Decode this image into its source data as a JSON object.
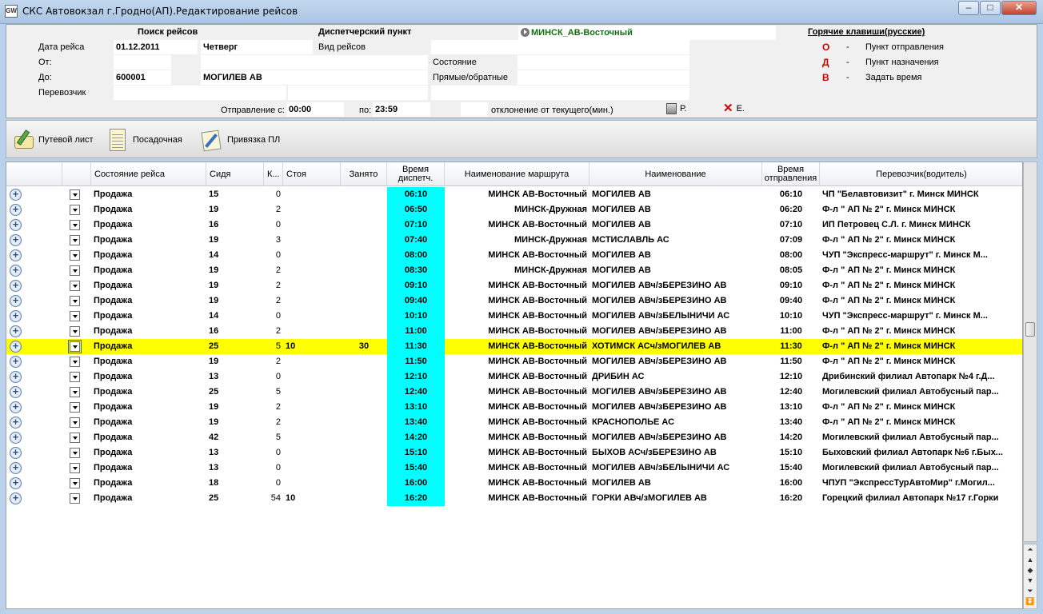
{
  "window": {
    "title": "СКС Автовокзал г.Гродно(АП).Редактирование рейсов",
    "logo": "GW",
    "minimize": "–",
    "maximize": "□",
    "close": "✕"
  },
  "search": {
    "header": "Поиск рейсов",
    "date_label": "Дата рейса",
    "date_value": "01.12.2011",
    "weekday": "Четверг",
    "from_label": "От:",
    "to_label": "До:",
    "to_code": "600001",
    "to_name": "МОГИЛЕВ АВ",
    "carrier_label": "Перевозчик",
    "dep_from_label": "Отправление с:",
    "dep_from_value": "00:00",
    "dep_to_label": "по:",
    "dep_to_value": "23:59",
    "deviation_label": "отклонение от текущего(мин.)",
    "print_label": "Р.",
    "clear_label": "Е."
  },
  "dispatch": {
    "header": "Диспетчерский пункт",
    "point": "МИНСК_АВ-Восточный",
    "trip_type_label": "Вид рейсов",
    "state_label": "Состояние",
    "direction_label": "Прямые/обратные"
  },
  "hotkeys": {
    "header": "Горячие клавиши(русские)",
    "items": [
      {
        "key": "О",
        "dash": "-",
        "desc": "Пункт отправления"
      },
      {
        "key": "Д",
        "dash": "-",
        "desc": "Пункт назначения"
      },
      {
        "key": "В",
        "dash": "-",
        "desc": "Задать время"
      }
    ]
  },
  "toolbar": {
    "waybill": "Путевой лист",
    "boarding": "Посадочная",
    "binding": "Привязка ПЛ"
  },
  "grid": {
    "columns": {
      "state": "Состояние рейса",
      "seats": "Сидя",
      "k": "К...",
      "stand": "Стоя",
      "taken": "Занято",
      "disp_time": "Время диспетч.",
      "route": "Наименование маршрута",
      "name": "Наименование",
      "dep_time": "Время отправления",
      "carrier": "Перевозчик(водитель)"
    },
    "rows": [
      {
        "state": "Продажа",
        "seats": "15",
        "k": "0",
        "stand": "",
        "taken": "",
        "disp": "06:10",
        "route": "МИНСК АВ-Восточный",
        "name": "МОГИЛЕВ АВ",
        "dep": "06:10",
        "carrier": "ЧП \"Белавтовизит\" г. Минск МИНСК"
      },
      {
        "state": "Продажа",
        "seats": "19",
        "k": "2",
        "stand": "",
        "taken": "",
        "disp": "06:50",
        "route": "МИНСК-Дружная",
        "name": "МОГИЛЕВ АВ",
        "dep": "06:20",
        "carrier": "Ф-л \" АП № 2\" г. Минск МИНСК"
      },
      {
        "state": "Продажа",
        "seats": "16",
        "k": "0",
        "stand": "",
        "taken": "",
        "disp": "07:10",
        "route": "МИНСК АВ-Восточный",
        "name": "МОГИЛЕВ АВ",
        "dep": "07:10",
        "carrier": "ИП Петровец С.Л. г. Минск МИНСК"
      },
      {
        "state": "Продажа",
        "seats": "19",
        "k": "3",
        "stand": "",
        "taken": "",
        "disp": "07:40",
        "route": "МИНСК-Дружная",
        "name": "МСТИСЛАВЛЬ АС",
        "dep": "07:09",
        "carrier": "Ф-л \" АП № 2\" г. Минск МИНСК"
      },
      {
        "state": "Продажа",
        "seats": "14",
        "k": "0",
        "stand": "",
        "taken": "",
        "disp": "08:00",
        "route": "МИНСК АВ-Восточный",
        "name": "МОГИЛЕВ АВ",
        "dep": "08:00",
        "carrier": "ЧУП \"Экспресс-маршрут\" г. Минск М..."
      },
      {
        "state": "Продажа",
        "seats": "19",
        "k": "2",
        "stand": "",
        "taken": "",
        "disp": "08:30",
        "route": "МИНСК-Дружная",
        "name": "МОГИЛЕВ АВ",
        "dep": "08:05",
        "carrier": "Ф-л \" АП № 2\" г. Минск МИНСК"
      },
      {
        "state": "Продажа",
        "seats": "19",
        "k": "2",
        "stand": "",
        "taken": "",
        "disp": "09:10",
        "route": "МИНСК АВ-Восточный",
        "name": "МОГИЛЕВ АВч/зБЕРЕЗИНО АВ",
        "dep": "09:10",
        "carrier": "Ф-л \" АП № 2\" г. Минск МИНСК"
      },
      {
        "state": "Продажа",
        "seats": "19",
        "k": "2",
        "stand": "",
        "taken": "",
        "disp": "09:40",
        "route": "МИНСК АВ-Восточный",
        "name": "МОГИЛЕВ АВч/зБЕРЕЗИНО АВ",
        "dep": "09:40",
        "carrier": "Ф-л \" АП № 2\" г. Минск МИНСК"
      },
      {
        "state": "Продажа",
        "seats": "14",
        "k": "0",
        "stand": "",
        "taken": "",
        "disp": "10:10",
        "route": "МИНСК АВ-Восточный",
        "name": "МОГИЛЕВ АВч/зБЕЛЫНИЧИ АС",
        "dep": "10:10",
        "carrier": "ЧУП \"Экспресс-маршрут\" г. Минск М..."
      },
      {
        "state": "Продажа",
        "seats": "16",
        "k": "2",
        "stand": "",
        "taken": "",
        "disp": "11:00",
        "route": "МИНСК АВ-Восточный",
        "name": "МОГИЛЕВ АВч/зБЕРЕЗИНО АВ",
        "dep": "11:00",
        "carrier": "Ф-л \" АП № 2\" г. Минск МИНСК"
      },
      {
        "state": "Продажа",
        "seats": "25",
        "k": "5",
        "stand": "10",
        "taken": "30",
        "disp": "11:30",
        "route": "МИНСК АВ-Восточный",
        "name": "ХОТИМСК АСч/зМОГИЛЕВ АВ",
        "dep": "11:30",
        "carrier": "Ф-л \" АП № 2\" г. Минск МИНСК",
        "selected": true
      },
      {
        "state": "Продажа",
        "seats": "19",
        "k": "2",
        "stand": "",
        "taken": "",
        "disp": "11:50",
        "route": "МИНСК АВ-Восточный",
        "name": "МОГИЛЕВ АВч/зБЕРЕЗИНО АВ",
        "dep": "11:50",
        "carrier": "Ф-л \" АП № 2\" г. Минск МИНСК"
      },
      {
        "state": "Продажа",
        "seats": "13",
        "k": "0",
        "stand": "",
        "taken": "",
        "disp": "12:10",
        "route": "МИНСК АВ-Восточный",
        "name": "ДРИБИН АС",
        "dep": "12:10",
        "carrier": "Дрибинский филиал Автопарк №4 г.Д..."
      },
      {
        "state": "Продажа",
        "seats": "25",
        "k": "5",
        "stand": "",
        "taken": "",
        "disp": "12:40",
        "route": "МИНСК АВ-Восточный",
        "name": "МОГИЛЕВ АВч/зБЕРЕЗИНО АВ",
        "dep": "12:40",
        "carrier": "Могилевский филиал Автобусный пар..."
      },
      {
        "state": "Продажа",
        "seats": "19",
        "k": "2",
        "stand": "",
        "taken": "",
        "disp": "13:10",
        "route": "МИНСК АВ-Восточный",
        "name": "МОГИЛЕВ АВч/зБЕРЕЗИНО АВ",
        "dep": "13:10",
        "carrier": "Ф-л \" АП № 2\" г. Минск МИНСК"
      },
      {
        "state": "Продажа",
        "seats": "19",
        "k": "2",
        "stand": "",
        "taken": "",
        "disp": "13:40",
        "route": "МИНСК АВ-Восточный",
        "name": "КРАСНОПОЛЬЕ АС",
        "dep": "13:40",
        "carrier": "Ф-л \" АП № 2\" г. Минск МИНСК"
      },
      {
        "state": "Продажа",
        "seats": "42",
        "k": "5",
        "stand": "",
        "taken": "",
        "disp": "14:20",
        "route": "МИНСК АВ-Восточный",
        "name": "МОГИЛЕВ АВч/зБЕРЕЗИНО АВ",
        "dep": "14:20",
        "carrier": "Могилевский филиал Автобусный пар..."
      },
      {
        "state": "Продажа",
        "seats": "13",
        "k": "0",
        "stand": "",
        "taken": "",
        "disp": "15:10",
        "route": "МИНСК АВ-Восточный",
        "name": "БЫХОВ АСч/зБЕРЕЗИНО АВ",
        "dep": "15:10",
        "carrier": "Быховский филиал Автопарк №6 г.Бых..."
      },
      {
        "state": "Продажа",
        "seats": "13",
        "k": "0",
        "stand": "",
        "taken": "",
        "disp": "15:40",
        "route": "МИНСК АВ-Восточный",
        "name": "МОГИЛЕВ АВч/зБЕЛЫНИЧИ АС",
        "dep": "15:40",
        "carrier": "Могилевский филиал Автобусный пар..."
      },
      {
        "state": "Продажа",
        "seats": "18",
        "k": "0",
        "stand": "",
        "taken": "",
        "disp": "16:00",
        "route": "МИНСК АВ-Восточный",
        "name": "МОГИЛЕВ АВ",
        "dep": "16:00",
        "carrier": "ЧПУП \"ЭкспрессТурАвтоМир\" г.Могил..."
      },
      {
        "state": "Продажа",
        "seats": "25",
        "k": "54",
        "stand": "10",
        "taken": "",
        "disp": "16:20",
        "route": "МИНСК АВ-Восточный",
        "name": "ГОРКИ АВч/зМОГИЛЕВ АВ",
        "dep": "16:20",
        "carrier": "Горецкий филиал Автопарк №17 г.Горки"
      }
    ]
  },
  "colors": {
    "selected_row": "#ffff00",
    "dispatch_time_cell": "#00ffff",
    "hotkey_letter": "#d00000",
    "dispatch_point": "#107010"
  },
  "icons": {
    "row_expand": "plus-circle-icon",
    "row_menu": "dropdown-arrow-icon",
    "waybill": "pencil-document-icon",
    "boarding": "notepad-icon",
    "binding": "document-pen-icon",
    "print": "printer-icon",
    "clear": "red-x-icon",
    "dispatch_point": "play-circle-icon"
  }
}
